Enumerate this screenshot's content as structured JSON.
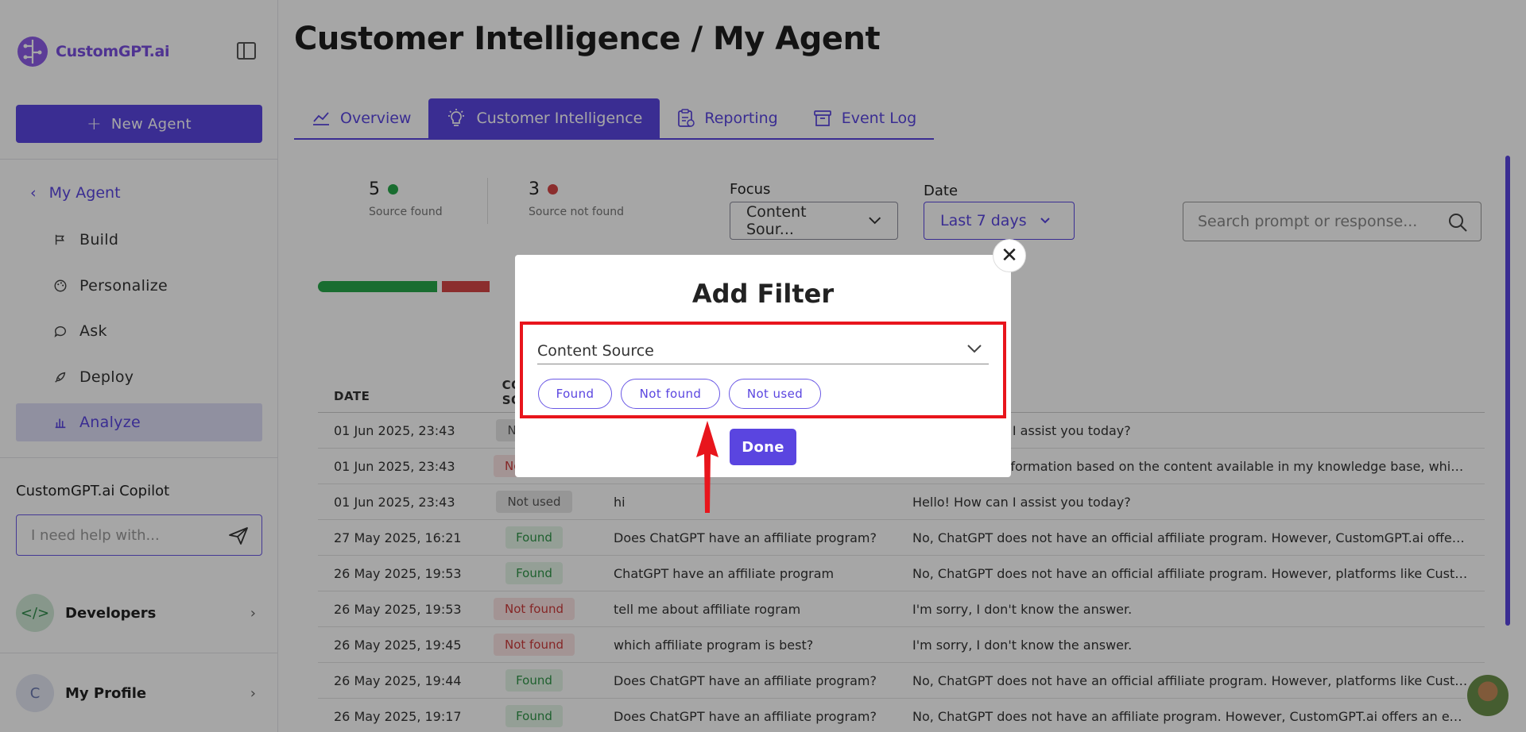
{
  "brand": {
    "name": "CustomGPT.ai",
    "accent": "#5a45e0"
  },
  "sidebar": {
    "new_agent_label": "New Agent",
    "back_label": "My Agent",
    "items": [
      {
        "label": "Build",
        "icon": "build-icon"
      },
      {
        "label": "Personalize",
        "icon": "palette-icon"
      },
      {
        "label": "Ask",
        "icon": "chat-icon"
      },
      {
        "label": "Deploy",
        "icon": "rocket-icon"
      },
      {
        "label": "Analyze",
        "icon": "bar-chart-icon",
        "active": true
      }
    ],
    "copilot_title": "CustomGPT.ai Copilot",
    "copilot_placeholder": "I need help with...",
    "developers_label": "Developers",
    "profile_label": "My Profile",
    "profile_initial": "C"
  },
  "main": {
    "title": "Customer Intelligence / My Agent",
    "tabs": [
      {
        "label": "Overview",
        "icon": "line-chart-icon"
      },
      {
        "label": "Customer Intelligence",
        "icon": "lightbulb-icon",
        "active": true
      },
      {
        "label": "Reporting",
        "icon": "clipboard-icon"
      },
      {
        "label": "Event Log",
        "icon": "archive-icon"
      }
    ],
    "stats": {
      "found_count": "5",
      "found_label": "Source found",
      "notfound_count": "3",
      "notfound_label": "Source not found",
      "found_fraction": 0.625,
      "colors": {
        "found": "#27a84a",
        "notfound": "#d64545"
      }
    },
    "filters": {
      "focus_label": "Focus",
      "focus_value": "Content Sour...",
      "date_label": "Date",
      "date_value": "Last 7 days",
      "search_placeholder": "Search prompt or response..."
    },
    "table": {
      "headers": {
        "date": "DATE",
        "cs_line1": "CO",
        "cs_line2": "SO"
      },
      "rows": [
        {
          "date": "01 Jun 2025, 23:43",
          "status": "Not used",
          "kind": "notused",
          "prompt": "",
          "response": "Hello! How can I assist you today?"
        },
        {
          "date": "01 Jun 2025, 23:43",
          "status": "Not found",
          "kind": "notfound",
          "prompt": "",
          "response": "I can provide information based on the content available in my knowledge base, whic..."
        },
        {
          "date": "01 Jun 2025, 23:43",
          "status": "Not used",
          "kind": "notused",
          "prompt": "hi",
          "response": "Hello! How can I assist you today?"
        },
        {
          "date": "27 May 2025, 16:21",
          "status": "Found",
          "kind": "found",
          "prompt": "Does ChatGPT have an affiliate program?",
          "response": "No, ChatGPT does not have an official affiliate program. However, CustomGPT.ai offers an ..."
        },
        {
          "date": "26 May 2025, 19:53",
          "status": "Found",
          "kind": "found",
          "prompt": "ChatGPT have an affiliate program",
          "response": "No, ChatGPT does not have an official affiliate program. However, platforms like CustomGP..."
        },
        {
          "date": "26 May 2025, 19:53",
          "status": "Not found",
          "kind": "notfound",
          "prompt": "tell me about affiliate rogram",
          "response": "I'm sorry, I don't know the answer."
        },
        {
          "date": "26 May 2025, 19:45",
          "status": "Not found",
          "kind": "notfound",
          "prompt": "which affiliate program is best?",
          "response": "I'm sorry, I don't know the answer."
        },
        {
          "date": "26 May 2025, 19:44",
          "status": "Found",
          "kind": "found",
          "prompt": "Does ChatGPT have an affiliate program?",
          "response": "No, ChatGPT does not have an official affiliate program. However, platforms like CustomGP..."
        },
        {
          "date": "26 May 2025, 19:17",
          "status": "Found",
          "kind": "found",
          "prompt": "Does ChatGPT have an affiliate program?",
          "response": "No, ChatGPT does not have an affiliate program. However, CustomGPT.ai offers an excellen..."
        }
      ]
    }
  },
  "modal": {
    "title": "Add Filter",
    "close_glyph": "✕",
    "select_value": "Content Source",
    "options": [
      "Found",
      "Not found",
      "Not used"
    ],
    "done_label": "Done",
    "highlight_color": "#e8151c"
  }
}
